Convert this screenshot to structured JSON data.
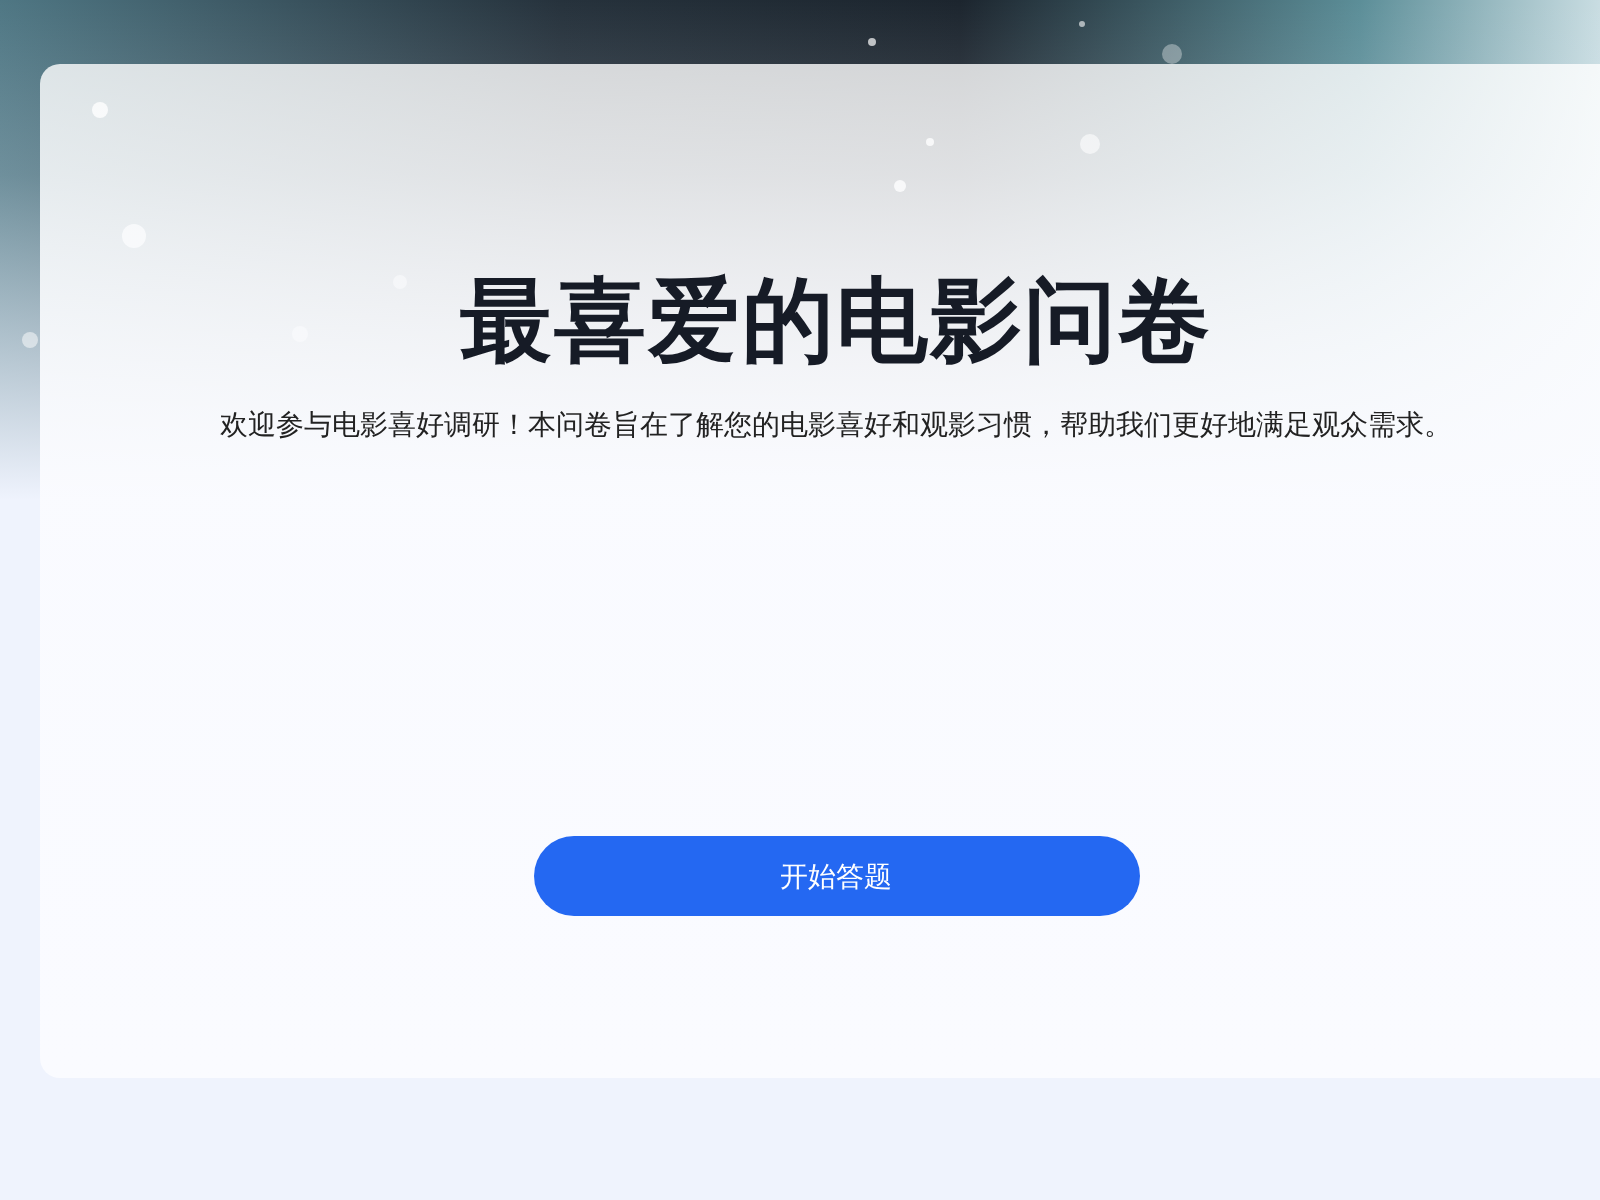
{
  "survey": {
    "title": "最喜爱的电影问卷",
    "description": "欢迎参与电影喜好调研！本问卷旨在了解您的电影喜好和观影习惯，帮助我们更好地满足观众需求。",
    "start_button": "开始答题"
  }
}
